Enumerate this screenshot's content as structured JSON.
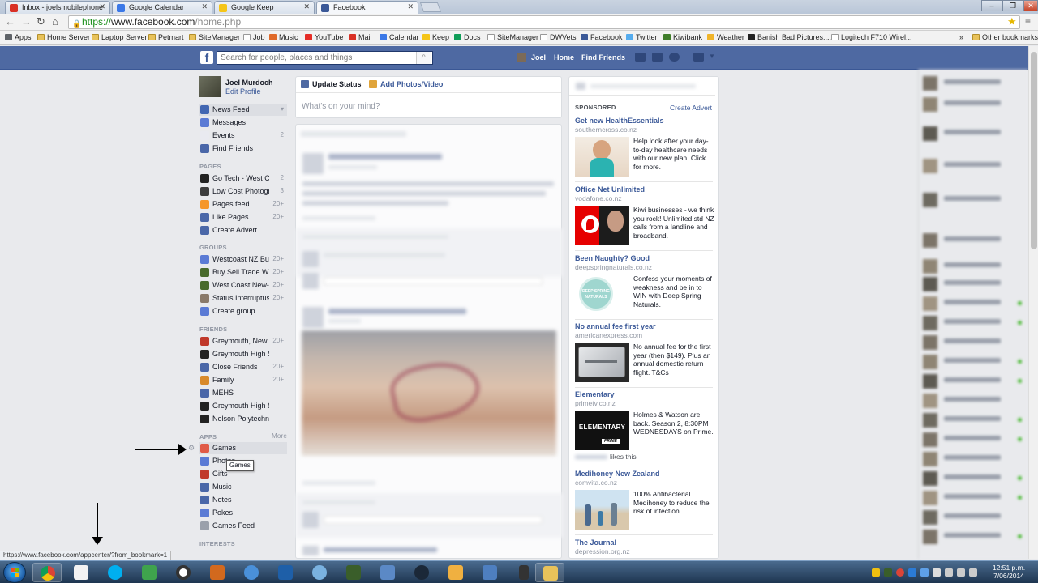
{
  "browser": {
    "tabs": [
      {
        "label": "Inbox - joelsmobilephone",
        "color": "#d93025"
      },
      {
        "label": "Google Calendar",
        "color": "#3b78e7"
      },
      {
        "label": "Google Keep",
        "color": "#f5c518"
      },
      {
        "label": "Facebook",
        "color": "#3b5998"
      }
    ],
    "tab_close": "✕",
    "url": {
      "scheme": "https://",
      "host": "www.facebook.com",
      "path": "/home.php"
    },
    "bookmarks": [
      "Apps",
      "Home Server",
      "Laptop Server",
      "Petmart",
      "SiteManager",
      "Job",
      "Music",
      "YouTube",
      "Mail",
      "Calendar",
      "Keep",
      "Docs",
      "SiteManager",
      "DWVets",
      "Facebook",
      "Twitter",
      "Kiwibank",
      "Weather",
      "Banish Bad Pictures:...",
      "Logitech F710 Wirel..."
    ],
    "bookmarks_overflow": "»",
    "other_bookmarks": "Other bookmarks",
    "status_url": "https://www.facebook.com/appcenter/?from_bookmark=1"
  },
  "fb": {
    "logo": "f",
    "search_placeholder": "Search for people, places and things",
    "nav": {
      "user": "Joel",
      "home": "Home",
      "find_friends": "Find Friends"
    },
    "profile": {
      "name": "Joel Murdoch",
      "edit": "Edit Profile"
    },
    "main_items": [
      {
        "label": "News Feed",
        "count": "▾",
        "icon": "#4267b2"
      },
      {
        "label": "Messages",
        "count": "",
        "icon": "#5b7bd5"
      },
      {
        "label": "Events",
        "count": "2",
        "icon": "#e9eaf0"
      },
      {
        "label": "Find Friends",
        "count": "",
        "icon": "#4a67a8"
      }
    ],
    "pages_header": "PAGES",
    "pages": [
      {
        "label": "Go Tech - West Co...",
        "count": "2",
        "icon": "#222222"
      },
      {
        "label": "Low Cost Photogra...",
        "count": "3",
        "icon": "#3d3d3d"
      },
      {
        "label": "Pages feed",
        "count": "20+",
        "icon": "#f5962a"
      },
      {
        "label": "Like Pages",
        "count": "20+",
        "icon": "#4a67a8"
      },
      {
        "label": "Create Advert",
        "count": "",
        "icon": "#4a67a8"
      }
    ],
    "groups_header": "GROUPS",
    "groups": [
      {
        "label": "Westcoast NZ Bu...",
        "count": "20+",
        "icon": "#5b7bd5"
      },
      {
        "label": "Buy Sell Trade W...",
        "count": "20+",
        "icon": "#496b2c"
      },
      {
        "label": "West Coast New-...",
        "count": "20+",
        "icon": "#496b2c"
      },
      {
        "label": "Status Interruptus",
        "count": "20+",
        "icon": "#8a7a6a"
      },
      {
        "label": "Create group",
        "count": "",
        "icon": "#5b7bd5"
      }
    ],
    "friends_header": "FRIENDS",
    "friends": [
      {
        "label": "Greymouth, New ...",
        "count": "20+",
        "icon": "#c0392b"
      },
      {
        "label": "Greymouth High School",
        "count": "",
        "icon": "#222222"
      },
      {
        "label": "Close Friends",
        "count": "20+",
        "icon": "#4a67a8"
      },
      {
        "label": "Family",
        "count": "20+",
        "icon": "#d88a2c"
      },
      {
        "label": "MEHS",
        "count": "",
        "icon": "#4a67a8"
      },
      {
        "label": "Greymouth High School",
        "count": "",
        "icon": "#222222"
      },
      {
        "label": "Nelson Polytechnic",
        "count": "",
        "icon": "#222222"
      }
    ],
    "apps_header": "APPS",
    "apps_more": "More",
    "apps": [
      {
        "label": "Games",
        "icon": "#e05a47"
      },
      {
        "label": "Photos",
        "icon": "#5b7bd5"
      },
      {
        "label": "Gifts",
        "icon": "#c0392b"
      },
      {
        "label": "Music",
        "icon": "#4a67a8"
      },
      {
        "label": "Notes",
        "icon": "#4a67a8"
      },
      {
        "label": "Pokes",
        "icon": "#5b7bd5"
      },
      {
        "label": "Games Feed",
        "icon": "#9aa0ab"
      }
    ],
    "interests_header": "INTERESTS",
    "tooltip": "Games",
    "composer": {
      "update_status": "Update Status",
      "add_photos": "Add Photos/Video",
      "placeholder": "What's on your mind?"
    },
    "sponsored": "SPONSORED",
    "create_advert": "Create Advert",
    "ads": [
      {
        "title": "Get new HealthEssentials",
        "domain": "southerncross.co.nz",
        "text": "Help look after your day-to-day healthcare needs with our new plan. Click for more."
      },
      {
        "title": "Office Net Unlimited",
        "domain": "vodafone.co.nz",
        "text": "Kiwi businesses - we think you rock! Unlimited std NZ calls from a landline and broadband."
      },
      {
        "title": "Been Naughty? Good",
        "domain": "deepspringnaturals.co.nz",
        "text": "Confess your moments of weakness and be in to WIN with Deep Spring Naturals."
      },
      {
        "title": "No annual fee first year",
        "domain": "americanexpress.com",
        "text": "No annual fee for the first year (then $149). Plus an annual domestic return flight. T&Cs"
      },
      {
        "title": "Elementary",
        "domain": "primetv.co.nz",
        "text": "Holmes & Watson are back. Season 2, 8:30PM WEDNESDAYS on Prime."
      },
      {
        "title": "Medihoney New Zealand",
        "domain": "comvita.co.nz",
        "text": "100% Antibacterial Medihoney to reduce the risk of infection."
      },
      {
        "title": "The Journal",
        "domain": "depression.org.nz",
        "text": ""
      }
    ],
    "ad_img_text": {
      "deepspring": "DEEP SPRING NATURALS",
      "elementary": "ELEMENTARY",
      "prime": "PRIME"
    },
    "ad_likes": "likes this"
  },
  "taskbar": {
    "time": "12:51 p.m.",
    "date": "7/06/2014"
  }
}
